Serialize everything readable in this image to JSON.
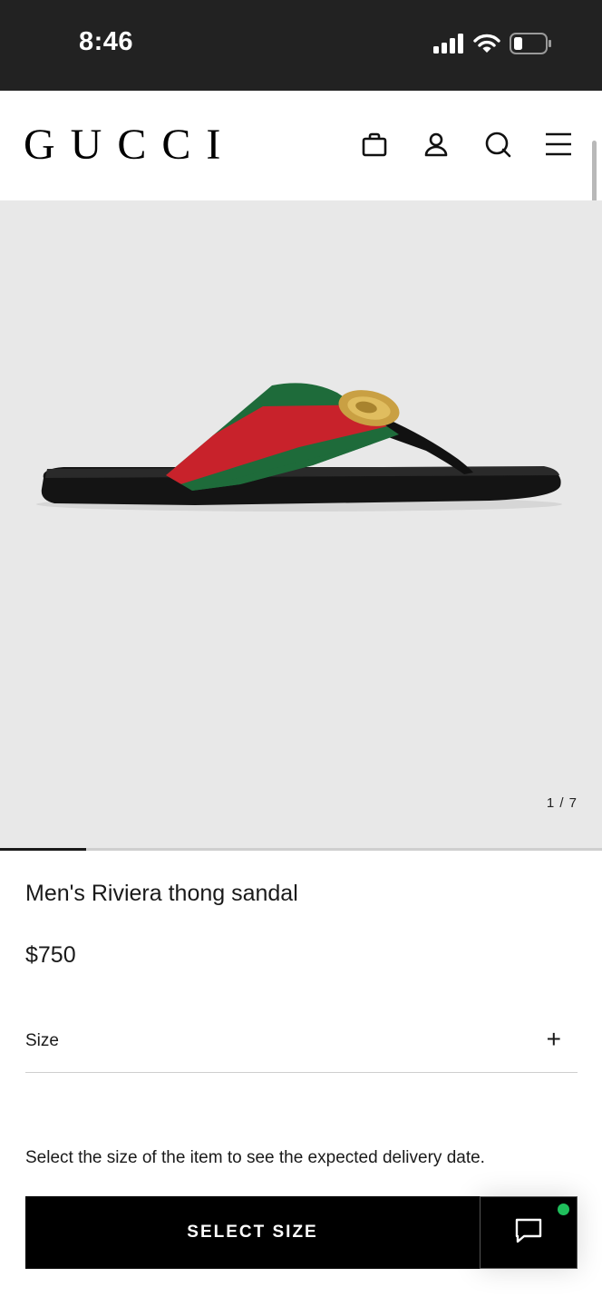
{
  "status_bar": {
    "time": "8:46",
    "icons": [
      "signal-icon",
      "wifi-icon",
      "battery-icon"
    ]
  },
  "header": {
    "logo": "GUCCI",
    "icons": [
      "shopping-bag-icon",
      "account-icon",
      "search-icon",
      "menu-icon"
    ]
  },
  "gallery": {
    "counter": "1 / 7",
    "current_image": 1,
    "total_images": 7
  },
  "product": {
    "name": "Men's Riviera thong sandal",
    "price": "$750"
  },
  "size_selector": {
    "label": "Size",
    "expand_symbol": "+"
  },
  "delivery_note": "Select the size of the item to see the expected delivery date.",
  "actions": {
    "select_size_label": "SELECT SIZE",
    "chat_icon": "chat-bubble-icon"
  },
  "colors": {
    "status_bar_bg": "#222222",
    "image_bg": "#e8e8e8",
    "button_bg": "#000000",
    "online_dot": "#1fbf5c",
    "web_green": "#1e6b3a",
    "web_red": "#c8222b"
  }
}
